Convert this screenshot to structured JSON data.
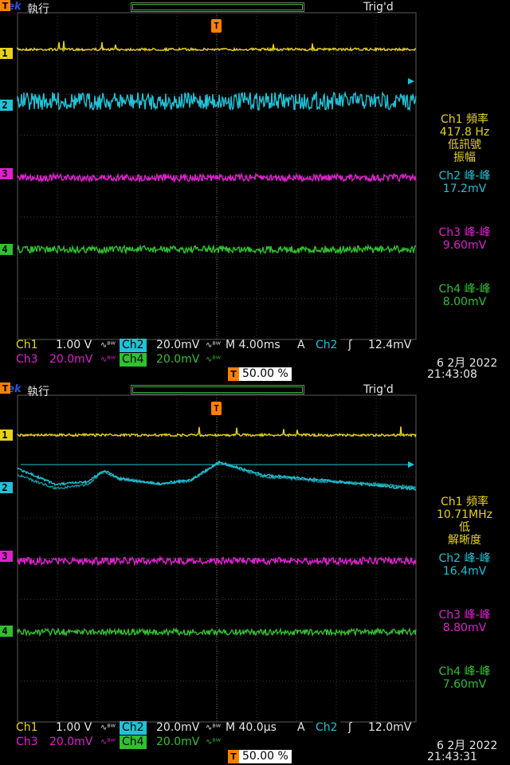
{
  "screens": [
    {
      "brand": "Tek",
      "run_state": "執行",
      "trig_status": "Trig'd",
      "trigger_marker": "T",
      "channel_markers": [
        "1",
        "2",
        "3",
        "4"
      ],
      "measurements": {
        "ch1_name": "Ch1 頻率",
        "ch1_value": "417.8 Hz",
        "ch1_note1": "低訊號",
        "ch1_note2": "振幅",
        "ch2_name": "Ch2 峰-峰",
        "ch2_value": "17.2mV",
        "ch3_name": "Ch3 峰-峰",
        "ch3_value": "9.60mV",
        "ch4_name": "Ch4 峰-峰",
        "ch4_value": "8.00mV"
      },
      "status": {
        "ch1_label": "Ch1",
        "ch1_scale": "1.00 V",
        "ch2_label": "Ch2",
        "ch2_scale": "20.0mV",
        "timebase": "M 4.00ms",
        "trig_mode": "A",
        "trig_src": "Ch2",
        "trig_level": "12.4mV",
        "ch3_label": "Ch3",
        "ch3_scale": "20.0mV",
        "ch4_label": "Ch4",
        "ch4_scale": "20.0mV",
        "trig_position": "50.00 %",
        "date": "6 2月  2022",
        "time": "21:43:08"
      },
      "colors": {
        "ch1": "#e6d21a",
        "ch2": "#1fc2d6",
        "ch3": "#e020d0",
        "ch4": "#30c030"
      }
    },
    {
      "brand": "Tek",
      "run_state": "執行",
      "trig_status": "Trig'd",
      "trigger_marker": "T",
      "channel_markers": [
        "1",
        "2",
        "3",
        "4"
      ],
      "measurements": {
        "ch1_name": "Ch1 頻率",
        "ch1_value": "10.71MHz",
        "ch1_note1": "低",
        "ch1_note2": "解晰度",
        "ch2_name": "Ch2 峰-峰",
        "ch2_value": "16.4mV",
        "ch3_name": "Ch3 峰-峰",
        "ch3_value": "8.80mV",
        "ch4_name": "Ch4 峰-峰",
        "ch4_value": "7.60mV"
      },
      "status": {
        "ch1_label": "Ch1",
        "ch1_scale": "1.00 V",
        "ch2_label": "Ch2",
        "ch2_scale": "20.0mV",
        "timebase": "M 40.0µs",
        "trig_mode": "A",
        "trig_src": "Ch2",
        "trig_level": "12.0mV",
        "ch3_label": "Ch3",
        "ch3_scale": "20.0mV",
        "ch4_label": "Ch4",
        "ch4_scale": "20.0mV",
        "trig_position": "50.00 %",
        "date": "6 2月  2022",
        "time": "21:43:31"
      },
      "colors": {
        "ch1": "#e6d21a",
        "ch2": "#1fc2d6",
        "ch3": "#e020d0",
        "ch4": "#30c030"
      }
    }
  ],
  "icons": {
    "coupling": "ac-coupling-bandwidth-icon",
    "trigger_slope": "rising-edge-icon"
  }
}
